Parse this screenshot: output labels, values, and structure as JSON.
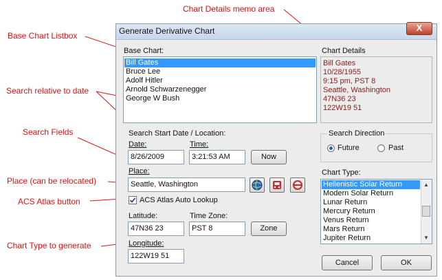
{
  "window": {
    "title": "Generate Derivative Chart",
    "close_label": "X"
  },
  "base_chart": {
    "label": "Base Chart:",
    "items": [
      "Bill Gates",
      "Bruce Lee",
      "Adolf Hitler",
      "Arnold Schwarzenegger",
      "George W Bush"
    ],
    "selected_index": 0
  },
  "chart_details": {
    "label": "Chart Details",
    "lines": [
      "Bill Gates",
      "10/28/1955",
      "9:15 pm, PST 8",
      "Seattle, Washington",
      "47N36 23",
      "122W19 51"
    ]
  },
  "search": {
    "group_label": "Search Start Date / Location:",
    "date_label": "Date:",
    "date_value": "8/26/2009",
    "time_label": "Time:",
    "time_value": "3:21:53 AM",
    "now_button": "Now",
    "place_label": "Place:",
    "place_value": "Seattle, Washington",
    "atlas_checkbox_label": "ACS Atlas Auto Lookup",
    "atlas_checked": true,
    "latitude_label": "Latitude:",
    "latitude_value": "47N36 23",
    "timezone_label": "Time Zone:",
    "timezone_value": "PST 8",
    "zone_button": "Zone",
    "longitude_label": "Longitude:",
    "longitude_value": "122W19 51"
  },
  "direction": {
    "label": "Search Direction",
    "options": [
      "Future",
      "Past"
    ],
    "selected": "Future"
  },
  "chart_type": {
    "label": "Chart Type:",
    "items": [
      "Hellenistic Solar Return",
      "Modern Solar Return",
      "Lunar Return",
      "Mercury Return",
      "Venus Return",
      "Mars Return",
      "Jupiter Return"
    ],
    "selected_index": 0
  },
  "buttons": {
    "cancel": "Cancel",
    "ok": "OK"
  },
  "annotations": {
    "memo": "Chart Details memo area",
    "listbox": "Base Chart Listbox",
    "relative": "Search relative to date",
    "fields": "Search Fields",
    "place": "Place (can be relocated)",
    "atlas": "ACS Atlas button",
    "charttype": "Chart Type to generate"
  },
  "colors": {
    "annotation": "#e01010",
    "memo_text": "#8b1a1a",
    "selection": "#3399ff"
  },
  "icons": {
    "atlas": "globe-icon",
    "relocate": "car-icon",
    "clear": "no-entry-icon"
  }
}
